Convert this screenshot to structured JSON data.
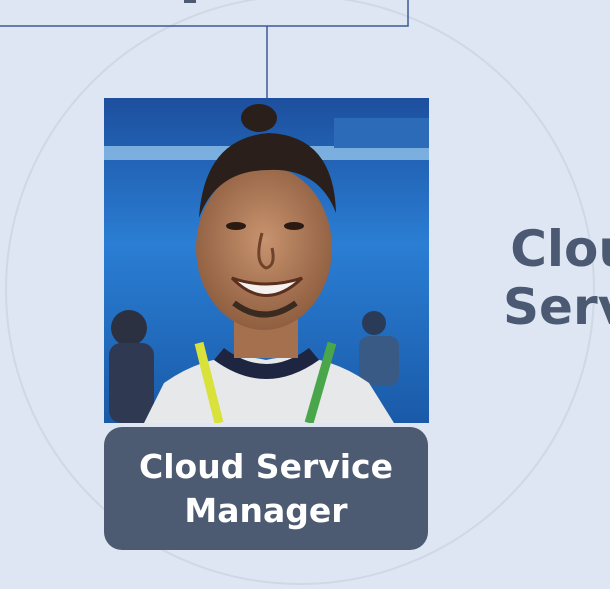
{
  "diagram": {
    "member_card": {
      "role_label": "Cloud Service Manager",
      "photo": "team-member-portrait"
    },
    "side_label": {
      "line1": "Cloud",
      "line2": "Servic"
    }
  },
  "colors": {
    "background": "#dde6f2",
    "card_fill": "#4c5a72",
    "card_text": "#ffffff",
    "side_text": "#4b5a72",
    "connector": "#3d5a97"
  }
}
